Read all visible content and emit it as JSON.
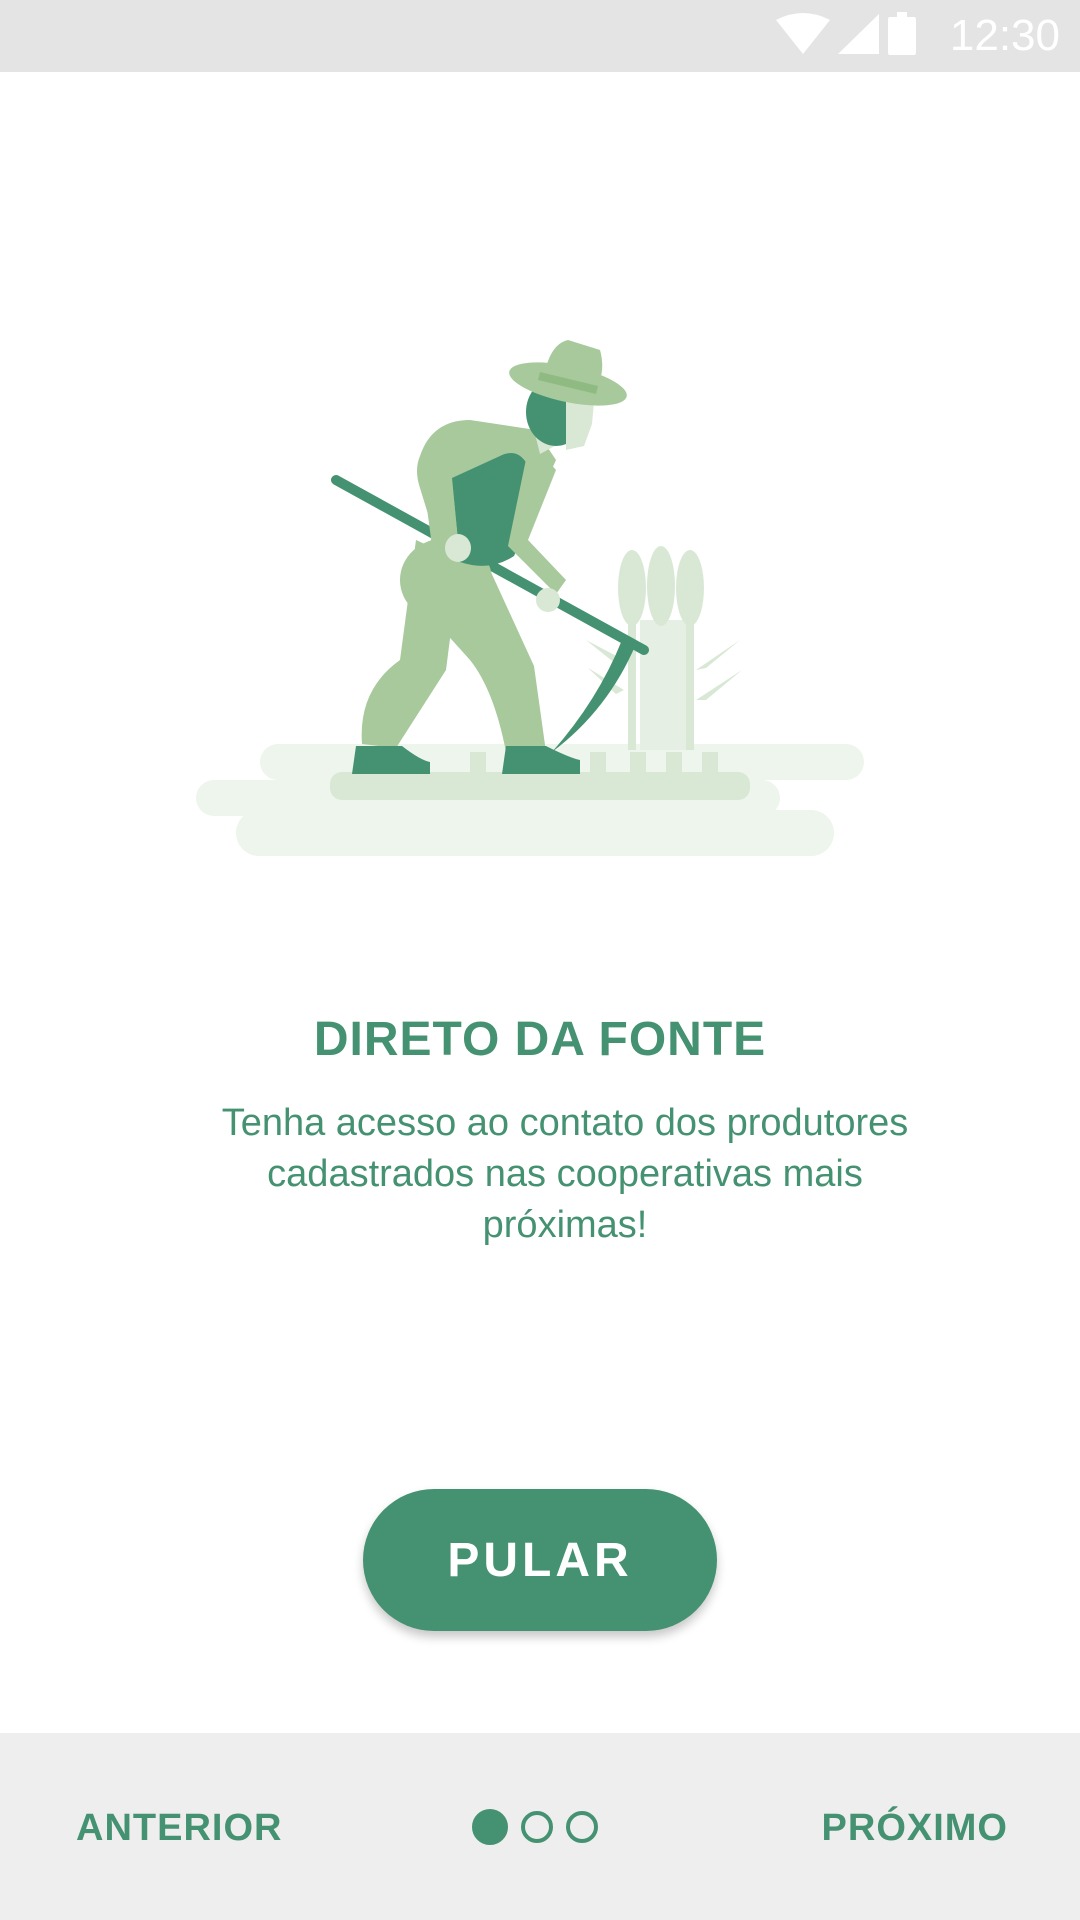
{
  "status_bar": {
    "time": "12:30",
    "icons": [
      "wifi-icon",
      "signal-icon",
      "battery-icon"
    ]
  },
  "onboarding": {
    "title": "DIRETO DA FONTE",
    "description": "Tenha acesso ao contato dos produtores cadastrados nas cooperativas mais próximas!",
    "illustration": "farmer-harvesting-illustration",
    "skip_label": "PULAR"
  },
  "bottom_nav": {
    "prev_label": "ANTERIOR",
    "next_label": "PRÓXIMO",
    "pages_total": 3,
    "current_page": 1
  },
  "colors": {
    "accent": "#459272",
    "light_green": "#a7c99c",
    "pale_green": "#d9e8d5",
    "status_bar_bg": "#e4e4e4",
    "bottom_bar_bg": "#eeeeee"
  }
}
